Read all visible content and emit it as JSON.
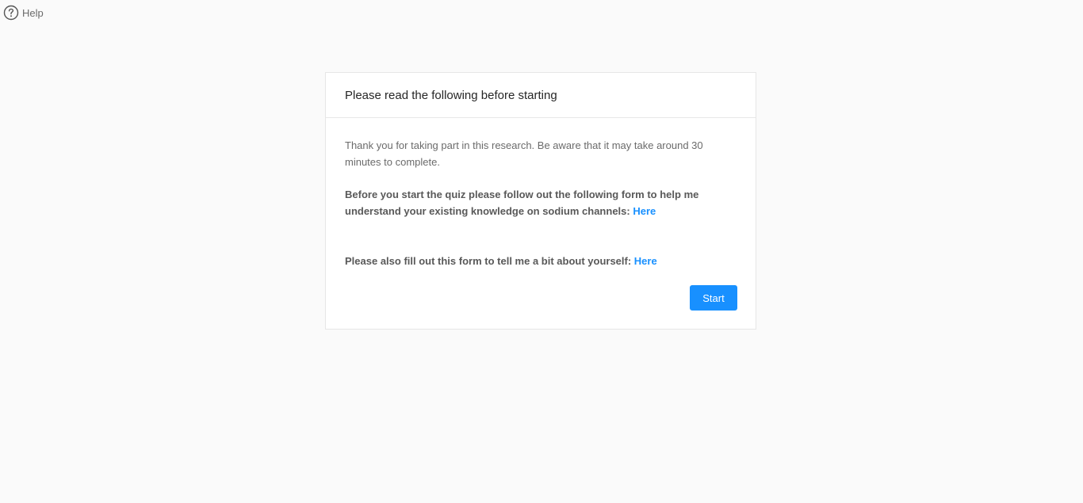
{
  "help": {
    "label": "Help",
    "icon": "question-circle-icon"
  },
  "card": {
    "title": "Please read the following before starting",
    "intro": "Thank you for taking part in this research. Be aware that it may take around 30 minutes to complete.",
    "knowledge_form_text": "Before you start the quiz please follow out the following form to help me understand your existing knowledge on sodium channels: ",
    "knowledge_form_link": "Here",
    "about_form_text": "Please also fill out this form to tell me a bit about yourself: ",
    "about_form_link": "Here",
    "start_label": "Start"
  },
  "colors": {
    "accent": "#1890ff",
    "background": "#fafafa",
    "card_background": "#ffffff"
  }
}
